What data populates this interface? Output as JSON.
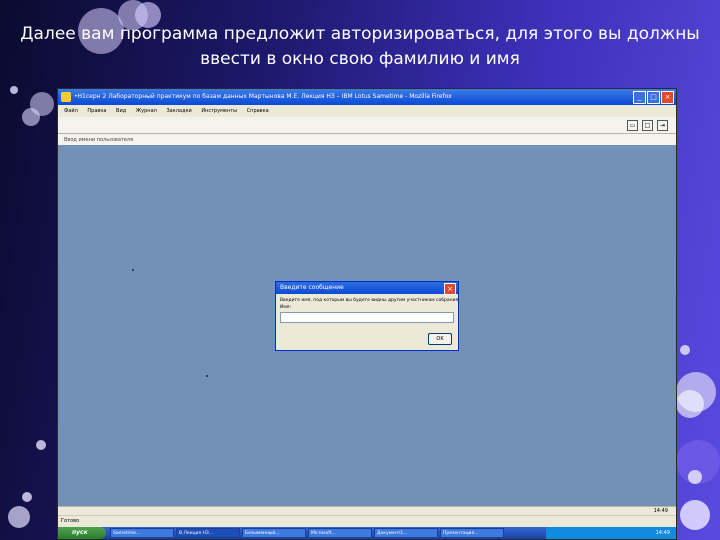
{
  "slide": {
    "title_line1": "Далее вам программа предложит авторизироваться,  для этого вы должны",
    "title_line2": "ввести в окно свою фамилию и имя"
  },
  "window": {
    "title": "•Н1серн 2 Лабораторный практикум по базам данных Мартынова М.Е. Лекция НЗ – IBM Lotus Sametime - Mozilla Firefox",
    "controls": [
      "_",
      "□",
      "×"
    ]
  },
  "menubar": [
    "Файл",
    "Правка",
    "Вид",
    "Журнал",
    "Закладки",
    "Инструменты",
    "Справка"
  ],
  "tab_label": "Ввод имени пользователя",
  "dialog": {
    "title": "Введите сообщение",
    "prompt": "Введите имя, под которым вы будете видны другим участникам собрания:",
    "field_label": "Имя:",
    "input_value": "",
    "ok_label": "OK"
  },
  "statusbar": {
    "left": "Готово",
    "right": "14:49"
  },
  "taskbar": {
    "start_label": "пуск",
    "items": [
      "Sametime...",
      "В.Лекция НЗ...",
      "Безымянный...",
      "Microsoft...",
      "Документ1...",
      "Презентация..."
    ],
    "clock": "14:49"
  },
  "colors": {
    "desktop_bg": "#7391b7",
    "xp_blue": "#0a49d6",
    "dialog_bg": "#ece9d8"
  }
}
